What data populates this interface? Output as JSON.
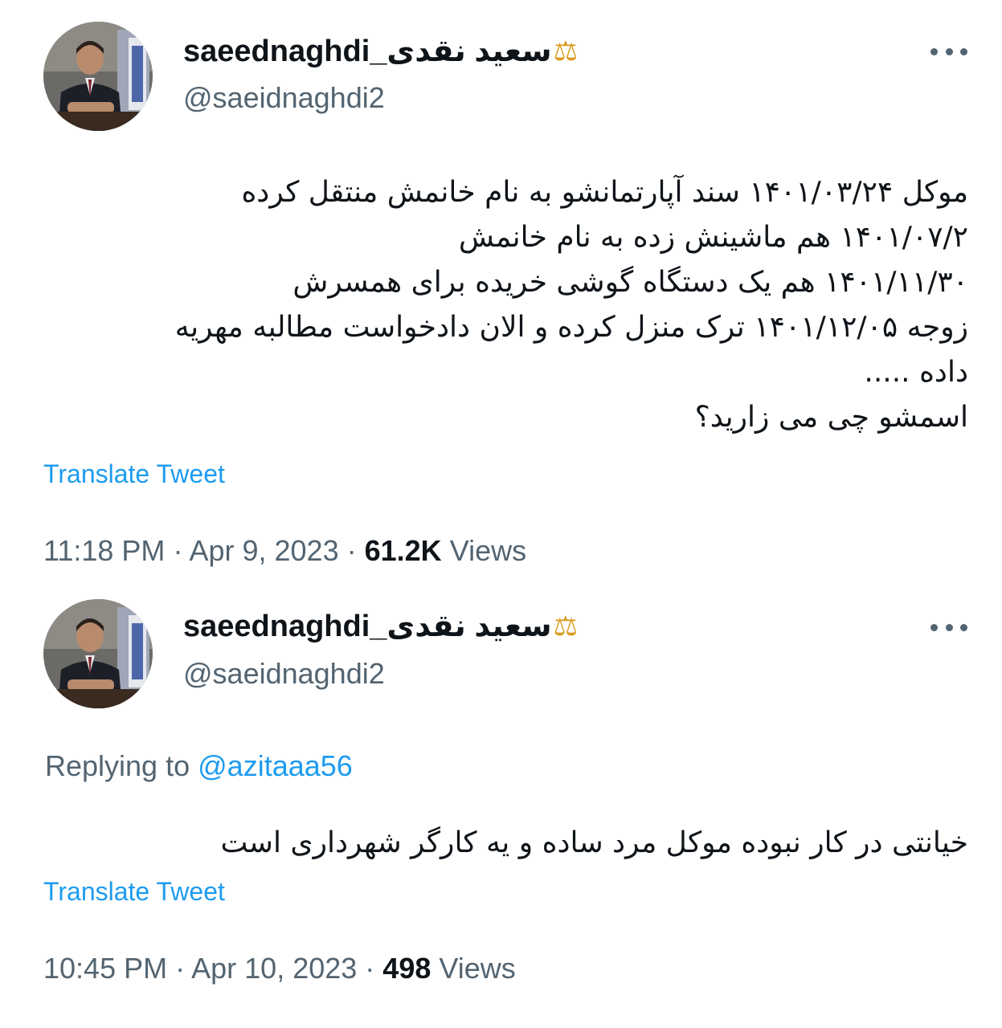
{
  "tweets": [
    {
      "display_name": "سعید نقدی_saeednaghdi",
      "display_icon": "balance-scale-icon",
      "handle": "@saeidnaghdi2",
      "replying_label": "",
      "replying_to": "",
      "body_lines": [
        "موکل ۱۴۰۱/۰۳/۲۴ سند آپارتمانشو به نام خانمش منتقل کرده",
        "۱۴۰۱/۰۷/۲ هم ماشینش زده به نام خانمش",
        "۱۴۰۱/۱۱/۳۰ هم یک دستگاه گوشی خریده برای همسرش",
        "زوجه ۱۴۰۱/۱۲/۰۵ ترک منزل کرده و الان دادخواست مطالبه مهریه",
        "داده .....",
        "اسمشو چی می زارید؟"
      ],
      "translate_label": "Translate Tweet",
      "time": "11:18 PM",
      "date": "Apr 9, 2023",
      "views_count": "61.2K",
      "views_label": "Views"
    },
    {
      "display_name": "سعید نقدی_saeednaghdi",
      "display_icon": "balance-scale-icon",
      "handle": "@saeidnaghdi2",
      "replying_label": "Replying to",
      "replying_to": "@azitaaa56",
      "body_lines": [
        "خیانتی در کار نبوده موکل مرد ساده و یه کارگر شهرداری است"
      ],
      "translate_label": "Translate Tweet",
      "time": "10:45 PM",
      "date": "Apr 10, 2023",
      "views_count": "498",
      "views_label": "Views"
    }
  ],
  "colors": {
    "link": "#1d9bf0",
    "secondary_text": "#536471",
    "primary_text": "#0f1419",
    "icon_gold": "#d99a1e"
  }
}
